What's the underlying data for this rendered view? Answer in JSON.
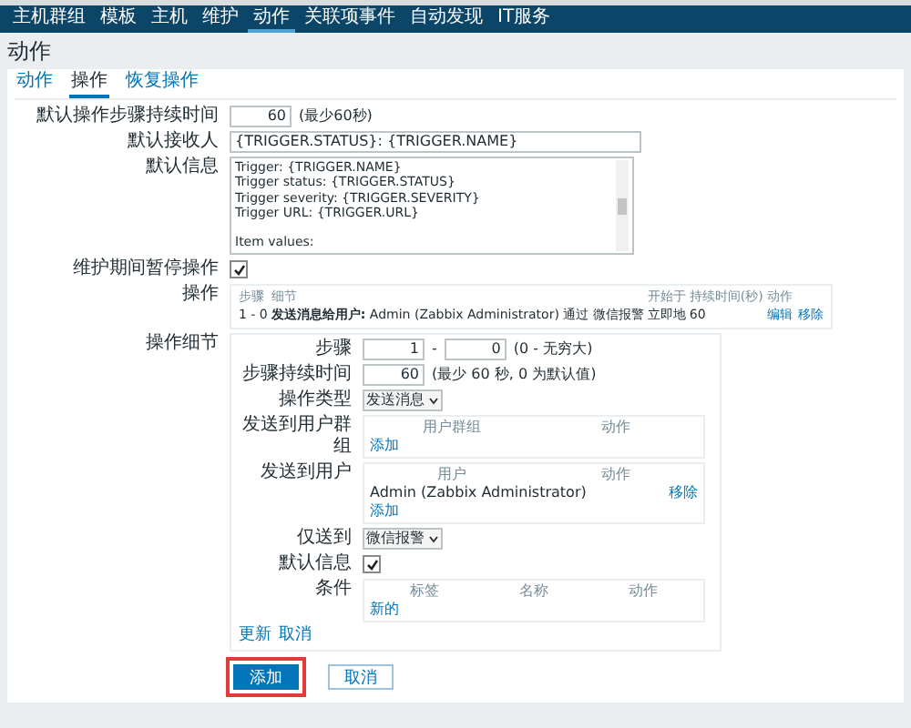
{
  "nav": [
    {
      "label": "主机群组",
      "selected": false
    },
    {
      "label": "模板",
      "selected": false
    },
    {
      "label": "主机",
      "selected": false
    },
    {
      "label": "维护",
      "selected": false
    },
    {
      "label": "动作",
      "selected": true
    },
    {
      "label": "关联项事件",
      "selected": false
    },
    {
      "label": "自动发现",
      "selected": false
    },
    {
      "label": "IT服务",
      "selected": false
    }
  ],
  "page_title": "动作",
  "tabs": [
    {
      "label": "动作",
      "selected": false
    },
    {
      "label": "操作",
      "selected": true
    },
    {
      "label": "恢复操作",
      "selected": false
    }
  ],
  "default_step_duration": {
    "label": "默认操作步骤持续时间",
    "value": "60",
    "hint": "(最少60秒)"
  },
  "default_subject": {
    "label": "默认接收人",
    "value": "{TRIGGER.STATUS}: {TRIGGER.NAME}"
  },
  "default_message": {
    "label": "默认信息",
    "paragraphs": [
      [
        "Trigger: {TRIGGER.NAME}",
        "Trigger status: {TRIGGER.STATUS}",
        "Trigger severity: {TRIGGER.SEVERITY}",
        "Trigger URL: {TRIGGER.URL}"
      ],
      [
        "Item values:"
      ]
    ]
  },
  "pause_in_maintenance": {
    "label": "维护期间暂停操作",
    "checked": true
  },
  "operations": {
    "label": "操作",
    "columns": [
      "步骤",
      "细节",
      "开始于",
      "持续时间(秒)",
      "动作"
    ],
    "rows": [
      {
        "steps": "1 - 0",
        "details": "**发送消息给用户:** Admin (Zabbix Administrator) 通过 微信报警",
        "start_in": "立即地",
        "duration": "60",
        "actions": [
          "编辑",
          "移除"
        ]
      }
    ]
  },
  "operation_details": {
    "label": "操作细节",
    "step": {
      "label": "步骤",
      "from": "1",
      "separator": "-",
      "to": "0",
      "hint": "(0 - 无穷大)"
    },
    "step_duration": {
      "label": "步骤持续时间",
      "value": "60",
      "hint": "(最少 60 秒, 0 为默认值)"
    },
    "operation_type": {
      "label": "操作类型",
      "value": "发送消息"
    },
    "user_groups": {
      "label": "发送到用户群组",
      "columns": [
        "用户群组",
        "动作"
      ],
      "add_link": "添加"
    },
    "users": {
      "label": "发送到用户",
      "columns": [
        "用户",
        "动作"
      ],
      "rows": [
        {
          "name": "Admin (Zabbix Administrator)",
          "action": "移除"
        }
      ],
      "add_link": "添加"
    },
    "send_only_to": {
      "label": "仅送到",
      "value": "微信报警"
    },
    "default_message": {
      "label": "默认信息",
      "checked": true
    },
    "conditions": {
      "label": "条件",
      "columns": [
        "标签",
        "名称",
        "动作"
      ],
      "new_link": "新的"
    },
    "links": [
      "更新",
      "取消"
    ]
  },
  "buttons": [
    {
      "label": "添加",
      "kind": "primary",
      "highlighted": true
    },
    {
      "label": "取消",
      "kind": "secondary",
      "highlighted": false
    }
  ]
}
